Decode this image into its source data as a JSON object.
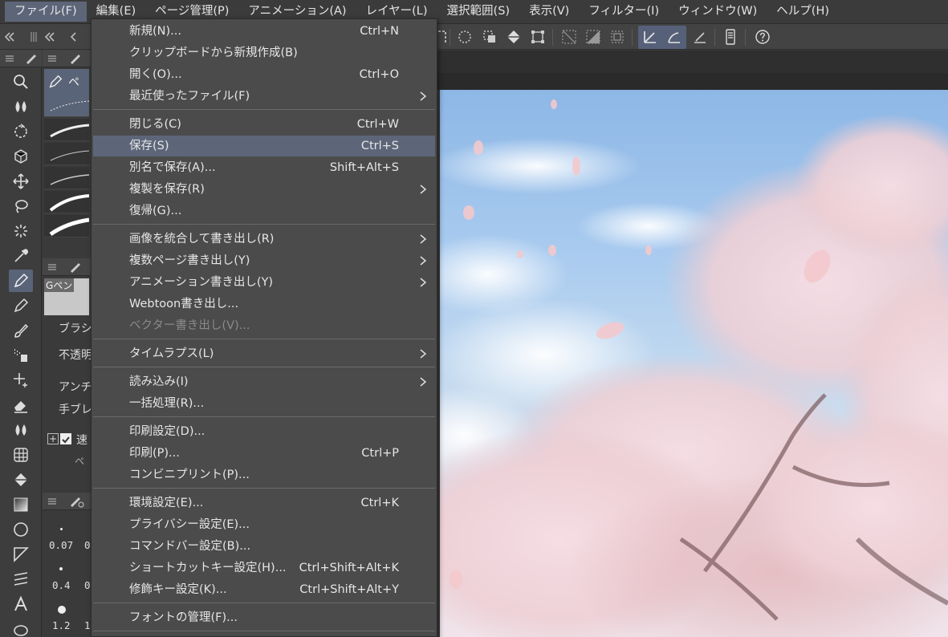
{
  "menubar": {
    "items": [
      {
        "label": "ファイル(F)",
        "active": true
      },
      {
        "label": "編集(E)"
      },
      {
        "label": "ページ管理(P)"
      },
      {
        "label": "アニメーション(A)"
      },
      {
        "label": "レイヤー(L)"
      },
      {
        "label": "選択範囲(S)"
      },
      {
        "label": "表示(V)"
      },
      {
        "label": "フィルター(I)"
      },
      {
        "label": "ウィンドウ(W)"
      },
      {
        "label": "ヘルプ(H)"
      }
    ]
  },
  "file_menu": {
    "items": [
      {
        "label": "新規(N)...",
        "shortcut": "Ctrl+N"
      },
      {
        "label": "クリップボードから新規作成(B)",
        "shortcut": ""
      },
      {
        "label": "開く(O)...",
        "shortcut": "Ctrl+O"
      },
      {
        "label": "最近使ったファイル(F)",
        "shortcut": "",
        "submenu": true
      },
      {
        "label": "閉じる(C)",
        "shortcut": "Ctrl+W"
      },
      {
        "label": "保存(S)",
        "shortcut": "Ctrl+S",
        "highlighted": true
      },
      {
        "label": "別名で保存(A)...",
        "shortcut": "Shift+Alt+S"
      },
      {
        "label": "複製を保存(R)",
        "shortcut": "",
        "submenu": true
      },
      {
        "label": "復帰(G)...",
        "shortcut": ""
      },
      {
        "label": "画像を統合して書き出し(R)",
        "shortcut": "",
        "submenu": true
      },
      {
        "label": "複数ページ書き出し(Y)",
        "shortcut": "",
        "submenu": true
      },
      {
        "label": "アニメーション書き出し(Y)",
        "shortcut": "",
        "submenu": true
      },
      {
        "label": "Webtoon書き出し...",
        "shortcut": ""
      },
      {
        "label": "ベクター書き出し(V)...",
        "shortcut": "",
        "disabled": true
      },
      {
        "label": "タイムラプス(L)",
        "shortcut": "",
        "submenu": true
      },
      {
        "label": "読み込み(I)",
        "shortcut": "",
        "submenu": true
      },
      {
        "label": "一括処理(R)...",
        "shortcut": ""
      },
      {
        "label": "印刷設定(D)...",
        "shortcut": ""
      },
      {
        "label": "印刷(P)...",
        "shortcut": "Ctrl+P"
      },
      {
        "label": "コンビニプリント(P)...",
        "shortcut": ""
      },
      {
        "label": "環境設定(E)...",
        "shortcut": "Ctrl+K"
      },
      {
        "label": "プライバシー設定(E)...",
        "shortcut": ""
      },
      {
        "label": "コマンドバー設定(B)...",
        "shortcut": ""
      },
      {
        "label": "ショートカットキー設定(H)...",
        "shortcut": "Ctrl+Shift+Alt+K"
      },
      {
        "label": "修飾キー設定(K)...",
        "shortcut": "Ctrl+Shift+Alt+Y"
      },
      {
        "label": "フォントの管理(F)...",
        "shortcut": ""
      }
    ]
  },
  "sub_tool": {
    "tab_label": "ペ",
    "preview_label": "Gペン",
    "props": [
      "ブラシ",
      "不透明",
      "アンチ",
      "手ブレ",
      "速"
    ],
    "extra_label": "ペ",
    "brush_sizes": [
      "0.07",
      "0.4",
      "1.2"
    ],
    "brush_sizes_col2": [
      "0",
      "0",
      "1"
    ]
  },
  "colors": {
    "menu_bg": "#4b4b4b",
    "highlight": "#5d6679",
    "menubar_bg": "#3b3b3b",
    "text": "#e6e6e6",
    "disabled_text": "#8a8a8a"
  }
}
